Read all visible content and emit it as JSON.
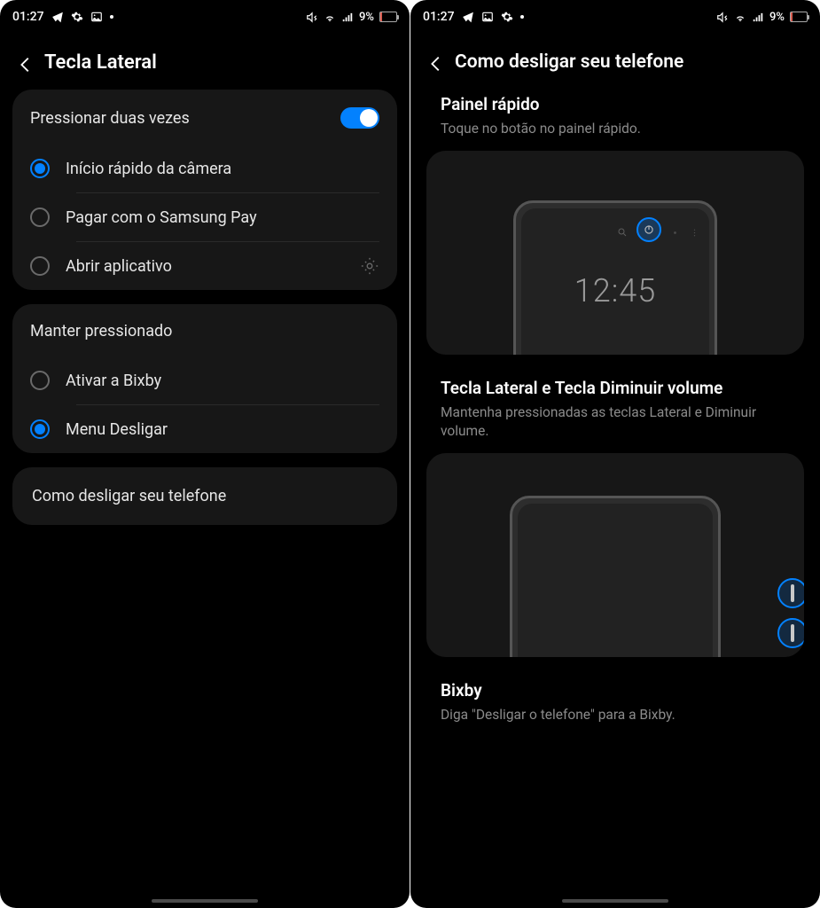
{
  "status": {
    "time": "01:27",
    "battery_pct": "9%"
  },
  "left": {
    "title": "Tecla Lateral",
    "section1": {
      "header": "Pressionar duas vezes",
      "options": [
        {
          "label": "Início rápido da câmera",
          "checked": true
        },
        {
          "label": "Pagar com o Samsung Pay",
          "checked": false
        },
        {
          "label": "Abrir aplicativo",
          "checked": false,
          "has_gear": true
        }
      ]
    },
    "section2": {
      "header": "Manter pressionado",
      "options": [
        {
          "label": "Ativar a Bixby",
          "checked": false
        },
        {
          "label": "Menu Desligar",
          "checked": true
        }
      ]
    },
    "link": "Como desligar seu telefone"
  },
  "right": {
    "title": "Como desligar seu telefone",
    "sec1": {
      "title": "Painel rápido",
      "desc": "Toque no botão no painel rápido.",
      "mock_time": "12:45"
    },
    "sec2": {
      "title": "Tecla Lateral e Tecla Diminuir volume",
      "desc": "Mantenha pressionadas as teclas Lateral e Diminuir volume."
    },
    "sec3": {
      "title": "Bixby",
      "desc": "Diga \"Desligar o telefone\" para a Bixby."
    }
  }
}
